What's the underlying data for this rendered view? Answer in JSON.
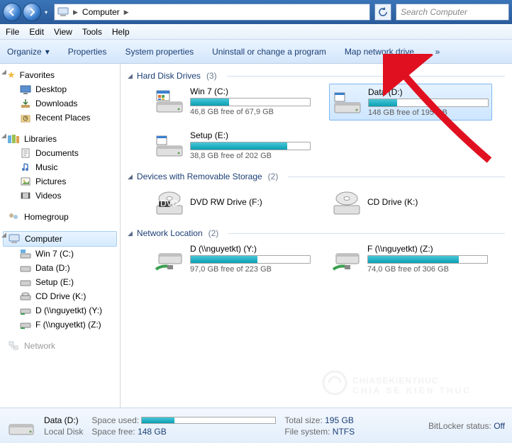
{
  "address": {
    "root": "Computer"
  },
  "search": {
    "placeholder": "Search Computer"
  },
  "menubar": [
    "File",
    "Edit",
    "View",
    "Tools",
    "Help"
  ],
  "toolbar": {
    "organize": "Organize",
    "properties": "Properties",
    "system_properties": "System properties",
    "uninstall": "Uninstall or change a program",
    "map_drive": "Map network drive",
    "more": "»"
  },
  "sidebar": {
    "favorites": {
      "label": "Favorites",
      "items": [
        "Desktop",
        "Downloads",
        "Recent Places"
      ]
    },
    "libraries": {
      "label": "Libraries",
      "items": [
        "Documents",
        "Music",
        "Pictures",
        "Videos"
      ]
    },
    "homegroup": {
      "label": "Homegroup"
    },
    "computer": {
      "label": "Computer",
      "items": [
        "Win 7 (C:)",
        "Data (D:)",
        "Setup (E:)",
        "CD Drive (K:)",
        "D (\\\\nguyetkt) (Y:)",
        "F (\\\\nguyetkt) (Z:)"
      ]
    },
    "network": {
      "label": "Network"
    }
  },
  "groups": [
    {
      "title": "Hard Disk Drives",
      "count": "(3)",
      "items": [
        {
          "name": "Win 7 (C:)",
          "free": "46,8 GB free of 67,9 GB",
          "fill": 32,
          "type": "hdd-os",
          "sel": false
        },
        {
          "name": "Data (D:)",
          "free": "148 GB free of 195 GB",
          "fill": 24,
          "type": "hdd",
          "sel": true
        },
        {
          "name": "Setup (E:)",
          "free": "38,8 GB free of 202 GB",
          "fill": 81,
          "type": "hdd",
          "sel": false
        }
      ]
    },
    {
      "title": "Devices with Removable Storage",
      "count": "(2)",
      "items": [
        {
          "name": "DVD RW Drive (F:)",
          "type": "dvd",
          "noinfo": true
        },
        {
          "name": "CD Drive (K:)",
          "type": "cd",
          "noinfo": true
        }
      ]
    },
    {
      "title": "Network Location",
      "count": "(2)",
      "items": [
        {
          "name": "D (\\\\nguyetkt) (Y:)",
          "free": "97,0 GB free of 223 GB",
          "fill": 56,
          "type": "net"
        },
        {
          "name": "F (\\\\nguyetkt) (Z:)",
          "free": "74,0 GB free of 306 GB",
          "fill": 76,
          "type": "net"
        }
      ]
    }
  ],
  "details": {
    "title": "Data (D:)",
    "subtitle": "Local Disk",
    "space_used_label": "Space used:",
    "space_used_fill": 24,
    "space_free_label": "Space free:",
    "space_free_val": "148 GB",
    "total_label": "Total size:",
    "total_val": "195 GB",
    "fs_label": "File system:",
    "fs_val": "NTFS",
    "bitlocker_label": "BitLocker status:",
    "bitlocker_val": "Off"
  },
  "watermark": {
    "main": "CHIASEKIENTHUC",
    "sub": "CHIA SE KIEN THUC"
  }
}
